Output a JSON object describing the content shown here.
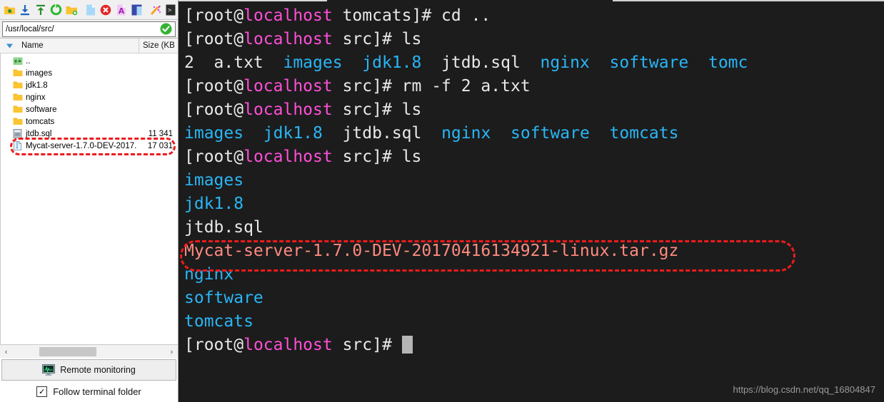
{
  "filepanel": {
    "toolbar": {
      "buttons": [
        {
          "name": "parent-folder-icon",
          "label": "Up one level"
        },
        {
          "name": "download-icon",
          "label": "Download"
        },
        {
          "name": "upload-icon",
          "label": "Upload"
        },
        {
          "name": "refresh-icon",
          "label": "Refresh"
        },
        {
          "name": "new-folder-icon",
          "label": "New folder"
        },
        {
          "name": "new-file-icon",
          "label": "New file"
        },
        {
          "name": "delete-icon",
          "label": "Delete"
        },
        {
          "name": "rename-icon",
          "label": "Rename"
        },
        {
          "name": "properties-icon",
          "label": "Properties"
        },
        {
          "name": "magic-wand-icon",
          "label": "Edit"
        },
        {
          "name": "terminal-icon",
          "label": "Open terminal here"
        }
      ]
    },
    "address": {
      "value": "/usr/local/src/",
      "placeholder": "/",
      "status_icon": "check-circle-icon"
    },
    "columns": {
      "name": "Name",
      "size": "Size (KB"
    },
    "rows": [
      {
        "icon": "parent-dir-icon",
        "name": "..",
        "size": ""
      },
      {
        "icon": "folder-icon",
        "name": "images",
        "size": ""
      },
      {
        "icon": "folder-icon",
        "name": "jdk1.8",
        "size": ""
      },
      {
        "icon": "folder-icon",
        "name": "nginx",
        "size": ""
      },
      {
        "icon": "folder-icon",
        "name": "software",
        "size": ""
      },
      {
        "icon": "folder-icon",
        "name": "tomcats",
        "size": ""
      },
      {
        "icon": "file-icon",
        "name": "jtdb.sql",
        "size": "11 341"
      },
      {
        "icon": "archive-file-icon",
        "name": "Mycat-server-1.7.0-DEV-2017...",
        "size": "17 031"
      }
    ],
    "scrollbar": {
      "left_arrow": "‹",
      "right_arrow": "›"
    },
    "remote_monitoring": {
      "label": "Remote monitoring",
      "icon": "monitor-icon"
    },
    "follow_terminal": {
      "label": "Follow terminal folder",
      "checked": true,
      "mark": "✓"
    }
  },
  "terminal": {
    "watermark": "https://blog.csdn.net/qq_16804847",
    "cursor_visible": true,
    "lines": [
      [
        {
          "t": "[root@",
          "c": "white"
        },
        {
          "t": "localhost",
          "c": "magenta"
        },
        {
          "t": " tomcats]# cd ..",
          "c": "white"
        }
      ],
      [
        {
          "t": "[root@",
          "c": "white"
        },
        {
          "t": "localhost",
          "c": "magenta"
        },
        {
          "t": " src]# ls",
          "c": "white"
        }
      ],
      [
        {
          "t": "2  a.txt  ",
          "c": "white"
        },
        {
          "t": "images",
          "c": "cyan"
        },
        {
          "t": "  ",
          "c": "white"
        },
        {
          "t": "jdk1.8",
          "c": "cyan"
        },
        {
          "t": "  jtdb.sql  ",
          "c": "white"
        },
        {
          "t": "nginx",
          "c": "cyan"
        },
        {
          "t": "  ",
          "c": "white"
        },
        {
          "t": "software",
          "c": "cyan"
        },
        {
          "t": "  ",
          "c": "white"
        },
        {
          "t": "tomc",
          "c": "cyan"
        }
      ],
      [
        {
          "t": "[root@",
          "c": "white"
        },
        {
          "t": "localhost",
          "c": "magenta"
        },
        {
          "t": " src]# rm -f 2 a.txt",
          "c": "white"
        }
      ],
      [
        {
          "t": "[root@",
          "c": "white"
        },
        {
          "t": "localhost",
          "c": "magenta"
        },
        {
          "t": " src]# ls",
          "c": "white"
        }
      ],
      [
        {
          "t": "images",
          "c": "cyan"
        },
        {
          "t": "  ",
          "c": "white"
        },
        {
          "t": "jdk1.8",
          "c": "cyan"
        },
        {
          "t": "  jtdb.sql  ",
          "c": "white"
        },
        {
          "t": "nginx",
          "c": "cyan"
        },
        {
          "t": "  ",
          "c": "white"
        },
        {
          "t": "software",
          "c": "cyan"
        },
        {
          "t": "  ",
          "c": "white"
        },
        {
          "t": "tomcats",
          "c": "cyan"
        }
      ],
      [
        {
          "t": "[root@",
          "c": "white"
        },
        {
          "t": "localhost",
          "c": "magenta"
        },
        {
          "t": " src]# ls",
          "c": "white"
        }
      ],
      [
        {
          "t": "images",
          "c": "cyan"
        }
      ],
      [
        {
          "t": "jdk1.8",
          "c": "cyan"
        }
      ],
      [
        {
          "t": "jtdb.sql",
          "c": "white"
        }
      ],
      [
        {
          "t": "Mycat-server-1.7.0-DEV-20170416134921-linux.tar.gz",
          "c": "salmon"
        }
      ],
      [
        {
          "t": "nginx",
          "c": "cyan"
        }
      ],
      [
        {
          "t": "software",
          "c": "cyan"
        }
      ],
      [
        {
          "t": "tomcats",
          "c": "cyan"
        }
      ],
      [
        {
          "t": "[root@",
          "c": "white"
        },
        {
          "t": "localhost",
          "c": "magenta"
        },
        {
          "t": " src]# ",
          "c": "white"
        },
        {
          "t": "",
          "c": "cursor"
        }
      ]
    ]
  },
  "annotations": [
    {
      "name": "annotation-mycat-tree-row",
      "color": "#ee1b1b",
      "style": "dashed-rounded-rect"
    },
    {
      "name": "annotation-mycat-terminal-line",
      "color": "#ee1b1b",
      "style": "dashed-rounded-rect"
    }
  ],
  "colors": {
    "terminal_bg": "#1c1c1c",
    "prompt_host": "#ff4fd8",
    "directory": "#29b6f6",
    "archive": "#ff8a80",
    "annotation": "#ee1b1b"
  }
}
